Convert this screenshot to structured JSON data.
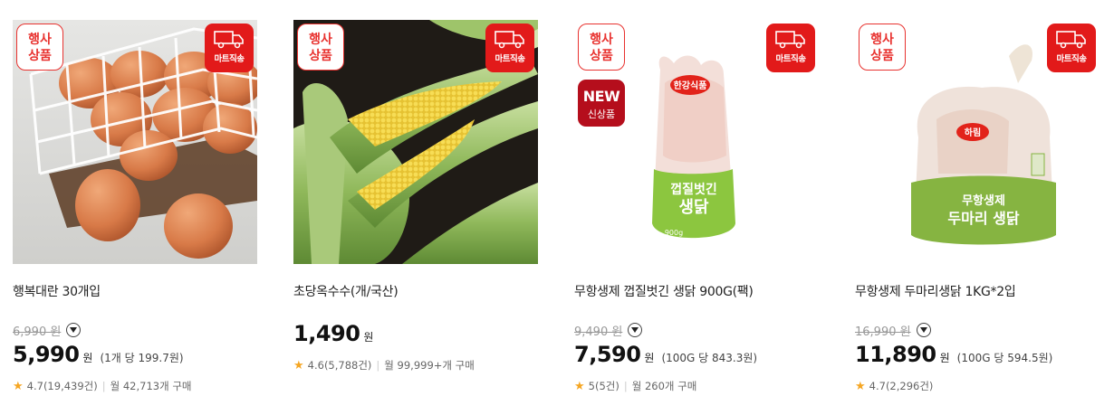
{
  "badges": {
    "event": [
      "행사",
      "상품"
    ],
    "delivery": "마트직송",
    "new": "NEW",
    "new_sub": "신상품"
  },
  "products": [
    {
      "name": "행복대란 30개입",
      "original_price": "6,990 원",
      "price": "5,990",
      "won": "원",
      "unit_price": "(1개 당 199.7원)",
      "rating": "4.7(19,439건)",
      "sales": "월 42,713개 구매",
      "is_new": false
    },
    {
      "name": "초당옥수수(개/국산)",
      "original_price": "",
      "price": "1,490",
      "won": "원",
      "unit_price": "",
      "rating": "4.6(5,788건)",
      "sales": "월 99,999+개 구매",
      "is_new": false
    },
    {
      "name": "무항생제 껍질벗긴 생닭 900G(팩)",
      "original_price": "9,490 원",
      "price": "7,590",
      "won": "원",
      "unit_price": "(100G 당 843.3원)",
      "rating": "5(5건)",
      "sales": "월 260개 구매",
      "is_new": true
    },
    {
      "name": "무항생제 두마리생닭 1KG*2입",
      "original_price": "16,990 원",
      "price": "11,890",
      "won": "원",
      "unit_price": "(100G 당 594.5원)",
      "rating": "4.7(2,296건)",
      "sales": "",
      "is_new": false
    }
  ],
  "package_text": {
    "p3_brand": "한강식품",
    "p3_line1": "껍질벗긴",
    "p3_line2": "생닭",
    "p3_weight": "900g",
    "p4_brand": "하림",
    "p4_line1": "무항생제",
    "p4_line2": "두마리 생닭"
  },
  "colors": {
    "accent": "#e21a1a",
    "new_badge": "#b50e1c",
    "star": "#f5a623"
  },
  "icons": [
    "truck-icon",
    "chevron-down-icon",
    "star-icon"
  ]
}
